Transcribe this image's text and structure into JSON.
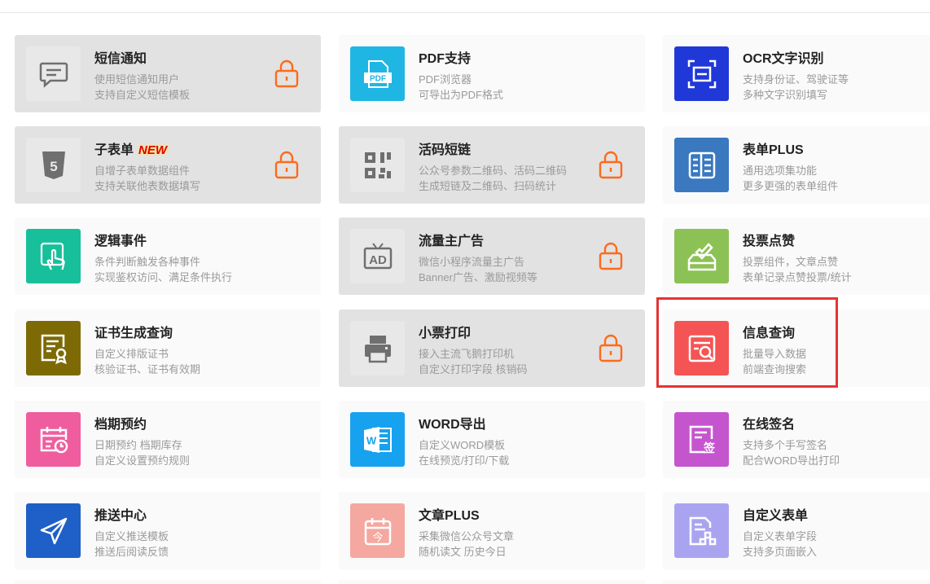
{
  "cards": [
    {
      "title": "短信通知",
      "badge": "",
      "desc1": "使用短信通知用户",
      "desc2": "支持自定义短信模板",
      "locked": true,
      "icon": "sms-icon",
      "color": "#e8e8e8"
    },
    {
      "title": "PDF支持",
      "badge": "",
      "desc1": "PDF浏览器",
      "desc2": "可导出为PDF格式",
      "locked": false,
      "icon": "pdf-icon",
      "color": "#1fb6e4",
      "icon_text": "PDF"
    },
    {
      "title": "OCR文字识别",
      "badge": "",
      "desc1": "支持身份证、驾驶证等",
      "desc2": "多种文字识别填写",
      "locked": false,
      "icon": "ocr-scan-icon",
      "color": "#2138d8"
    },
    {
      "title": "子表单",
      "badge": "NEW",
      "desc1": "自增子表单数据组件",
      "desc2": "支持关联他表数据填写",
      "locked": true,
      "icon": "html5-icon",
      "color": "#e8e8e8",
      "icon_text": "5"
    },
    {
      "title": "活码短链",
      "badge": "",
      "desc1": "公众号参数二维码、活码二维码",
      "desc2": "生成短链及二维码、扫码统计",
      "locked": true,
      "icon": "qrcode-icon",
      "color": "#e8e8e8"
    },
    {
      "title": "表单PLUS",
      "badge": "",
      "desc1": "通用选项集功能",
      "desc2": "更多更强的表单组件",
      "locked": false,
      "icon": "form-plus-icon",
      "color": "#3a78c0"
    },
    {
      "title": "逻辑事件",
      "badge": "",
      "desc1": "条件判断触发各种事件",
      "desc2": "实现鉴权访问、满足条件执行",
      "locked": false,
      "icon": "touch-icon",
      "color": "#17c09a"
    },
    {
      "title": "流量主广告",
      "badge": "",
      "desc1": "微信小程序流量主广告",
      "desc2": "Banner广告、激励视频等",
      "locked": true,
      "icon": "ad-icon",
      "color": "#e8e8e8",
      "icon_text": "AD"
    },
    {
      "title": "投票点赞",
      "badge": "",
      "desc1": "投票组件，文章点赞",
      "desc2": "表单记录点赞投票/统计",
      "locked": false,
      "icon": "vote-icon",
      "color": "#8cc255"
    },
    {
      "title": "证书生成查询",
      "badge": "",
      "desc1": "自定义排版证书",
      "desc2": "核验证书、证书有效期",
      "locked": false,
      "icon": "certificate-icon",
      "color": "#7d6a05"
    },
    {
      "title": "小票打印",
      "badge": "",
      "desc1": "接入主流飞鹅打印机",
      "desc2": "自定义打印字段 核销码",
      "locked": true,
      "icon": "printer-icon",
      "color": "#e8e8e8"
    },
    {
      "title": "信息查询",
      "badge": "",
      "desc1": "批量导入数据",
      "desc2": "前端查询搜索",
      "locked": false,
      "icon": "doc-search-icon",
      "color": "#f55454"
    },
    {
      "title": "档期预约",
      "badge": "",
      "desc1": "日期预约 档期库存",
      "desc2": "自定义设置预约规则",
      "locked": false,
      "icon": "calendar-icon",
      "color": "#ef5d9e"
    },
    {
      "title": "WORD导出",
      "badge": "",
      "desc1": "自定义WORD模板",
      "desc2": "在线预览/打印/下载",
      "locked": false,
      "icon": "word-icon",
      "color": "#16a2ef",
      "icon_text": "W"
    },
    {
      "title": "在线签名",
      "badge": "",
      "desc1": "支持多个手写签名",
      "desc2": "配合WORD导出打印",
      "locked": false,
      "icon": "signature-icon",
      "color": "#c455cf",
      "icon_text": "签"
    },
    {
      "title": "推送中心",
      "badge": "",
      "desc1": "自定义推送模板",
      "desc2": "推送后阅读反馈",
      "locked": false,
      "icon": "send-icon",
      "color": "#1f5fc8"
    },
    {
      "title": "文章PLUS",
      "badge": "",
      "desc1": "采集微信公众号文章",
      "desc2": "随机读文 历史今日",
      "locked": false,
      "icon": "article-calendar-icon",
      "color": "#f4a8a0",
      "icon_text": "今"
    },
    {
      "title": "自定义表单",
      "badge": "",
      "desc1": "自定义表单字段",
      "desc2": "支持多页面嵌入",
      "locked": false,
      "icon": "custom-form-icon",
      "color": "#aaa4f0"
    }
  ],
  "lock_color": "#ff6a1a",
  "highlight_color": "#e63333"
}
